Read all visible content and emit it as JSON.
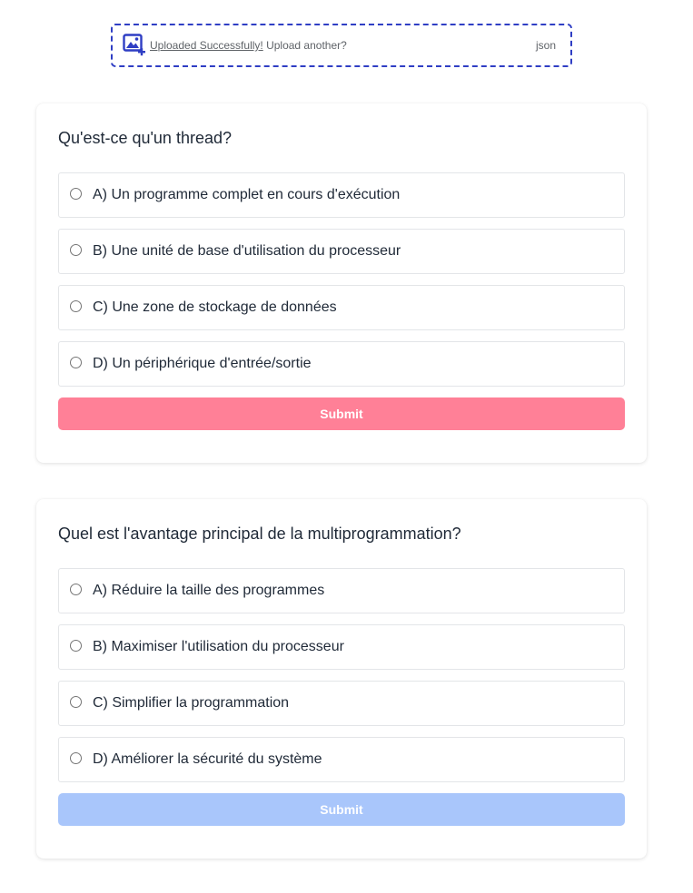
{
  "upload": {
    "link_text": "Uploaded Successfully!",
    "suffix_text": " Upload another?",
    "file_type": "json",
    "icon": "image-upload-icon",
    "border_color": "#2f3ec4"
  },
  "questions": [
    {
      "text": "Qu'est-ce qu'un thread?",
      "options": [
        "A) Un programme complet en cours d'exécution",
        "B) Une unité de base d'utilisation du processeur",
        "C) Une zone de stockage de données",
        "D) Un périphérique d'entrée/sortie"
      ],
      "submit_label": "Submit",
      "submit_color": "#ff8097"
    },
    {
      "text": "Quel est l'avantage principal de la multiprogrammation?",
      "options": [
        "A) Réduire la taille des programmes",
        "B) Maximiser l'utilisation du processeur",
        "C) Simplifier la programmation",
        "D) Améliorer la sécurité du système"
      ],
      "submit_label": "Submit",
      "submit_color": "#a9c6fb"
    }
  ]
}
